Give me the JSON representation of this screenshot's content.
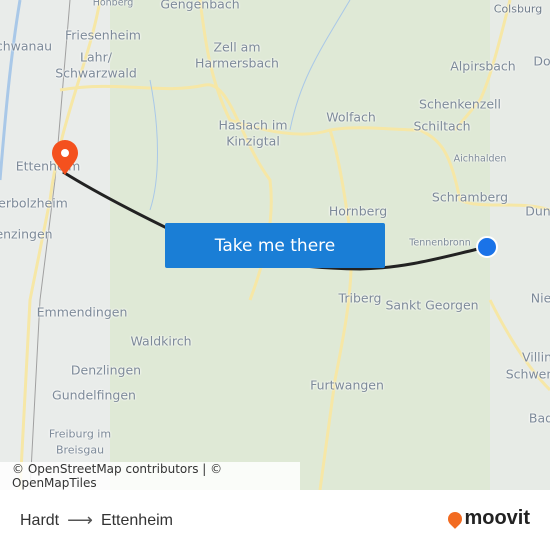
{
  "map": {
    "labels": [
      "Hohberg",
      "Gengenbach",
      "Schwanau",
      "Friesenheim",
      "Lahr/",
      "Schwarzwald",
      "Zell am",
      "Harmersbach",
      "Haslach im",
      "Kinzigtal",
      "Wolfach",
      "Alpirsbach",
      "Schenkenzell",
      "Schiltach",
      "Aichhalden",
      "Schramberg",
      "Hornberg",
      "Dun",
      "Do",
      "Ettenheim",
      "erbolzheim",
      "enzingen",
      "Tennenbronn",
      "Triberg",
      "Sankt Georgen",
      "Nie",
      "Emmendingen",
      "Waldkirch",
      "Denzlingen",
      "Gundelfingen",
      "Villin",
      "Schwen",
      "Furtwangen",
      "Freiburg im",
      "Breisgau",
      "Bad",
      "Colsburg"
    ],
    "origin_marker": "blue-dot",
    "destination_marker": "orange-pin",
    "route_color": "#222222",
    "button_color": "#1a7ed6",
    "cta_label": "Take me there",
    "attribution": "© OpenStreetMap contributors | © OpenMapTiles"
  },
  "footer": {
    "origin": "Hardt",
    "arrow": "⟶",
    "destination": "Ettenheim",
    "logo_text": "moovit",
    "brand_color": "#f26b21"
  }
}
